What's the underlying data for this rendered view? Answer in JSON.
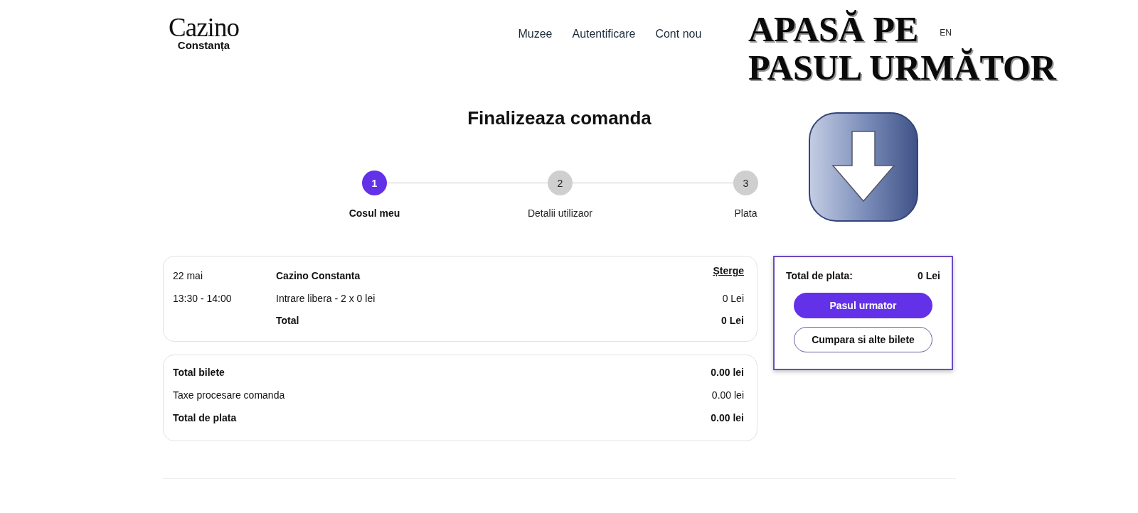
{
  "header": {
    "logo": {
      "title": "Cazino",
      "subtitle": "Constanța"
    },
    "nav": [
      "Muzee",
      "Autentificare",
      "Cont nou"
    ],
    "language": "EN"
  },
  "annotation": {
    "lines": [
      "APASĂ PE",
      "PASUL URMĂTOR"
    ]
  },
  "page_title": "Finalizeaza comanda",
  "steps": [
    {
      "number": "1",
      "label": "Cosul meu",
      "selected": true
    },
    {
      "number": "2",
      "label": "Detalii utilizaor",
      "selected": false
    },
    {
      "number": "3",
      "label": "Plata",
      "selected": false
    }
  ],
  "cart_item": {
    "date": "22 mai",
    "time": "13:30 - 14:00",
    "venue": "Cazino Constanta",
    "remove": "Șterge",
    "line": {
      "label": "Intrare libera - 2 x 0 lei",
      "amount": "0 Lei"
    },
    "total": {
      "label": "Total",
      "amount": "0 Lei"
    }
  },
  "summary": [
    {
      "label": "Total bilete",
      "amount": "0.00 lei",
      "kind": "total"
    },
    {
      "label": "Taxe procesare comanda",
      "amount": "0.00 lei",
      "kind": "fee"
    },
    {
      "label": "Total de plata",
      "amount": "0.00 lei",
      "kind": "total"
    }
  ],
  "checkout": {
    "total_label": "Total de plata:",
    "total_amount": "0 Lei",
    "buttons": [
      {
        "label": "Pasul urmator",
        "kind": "primary"
      },
      {
        "label": "Cumpara si alte bilete",
        "kind": "secondary"
      }
    ]
  }
}
